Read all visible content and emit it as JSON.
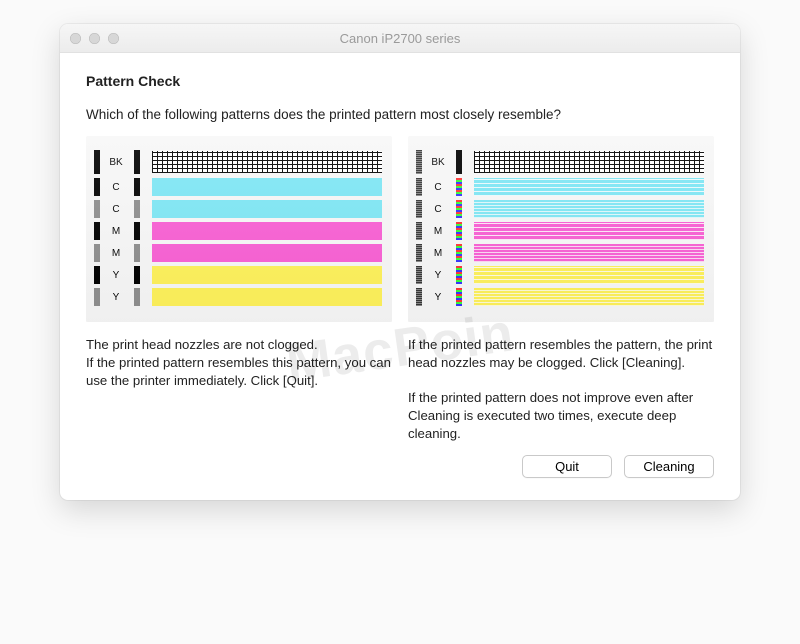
{
  "window": {
    "title": "Canon iP2700 series"
  },
  "heading": "Pattern Check",
  "question": "Which of the following patterns does the printed pattern most closely resemble?",
  "swatch_labels": {
    "bk": "BK",
    "c": "C",
    "m": "M",
    "y": "Y"
  },
  "panels": {
    "good": {
      "rows": [
        {
          "label_key": "bk",
          "type": "bk-grid"
        },
        {
          "label_key": "c",
          "type": "solid",
          "color": "cy"
        },
        {
          "label_key": "c",
          "type": "solid",
          "color": "cy"
        },
        {
          "label_key": "m",
          "type": "solid",
          "color": "mg"
        },
        {
          "label_key": "m",
          "type": "solid",
          "color": "mg"
        },
        {
          "label_key": "y",
          "type": "solid",
          "color": "yl"
        },
        {
          "label_key": "y",
          "type": "solid",
          "color": "yl"
        }
      ]
    },
    "bad": {
      "rows": [
        {
          "label_key": "bk",
          "type": "bk-grid-defect"
        },
        {
          "label_key": "c",
          "type": "streaky",
          "color": "cy"
        },
        {
          "label_key": "c",
          "type": "streaky",
          "color": "cy"
        },
        {
          "label_key": "m",
          "type": "streaky",
          "color": "mg"
        },
        {
          "label_key": "m",
          "type": "streaky",
          "color": "mg"
        },
        {
          "label_key": "y",
          "type": "streaky",
          "color": "yl"
        },
        {
          "label_key": "y",
          "type": "streaky",
          "color": "yl"
        }
      ]
    }
  },
  "captions": {
    "good": "The print head nozzles are not clogged.\nIf the printed pattern resembles this pattern, you can use the printer immediately. Click [Quit].",
    "bad_p1": "If the printed pattern resembles the pattern, the print head nozzles may be clogged. Click [Cleaning].",
    "bad_p2": "If the printed pattern does not improve even after Cleaning is executed two times, execute deep cleaning."
  },
  "buttons": {
    "quit": "Quit",
    "cleaning": "Cleaning"
  },
  "watermark": "MacPoin"
}
